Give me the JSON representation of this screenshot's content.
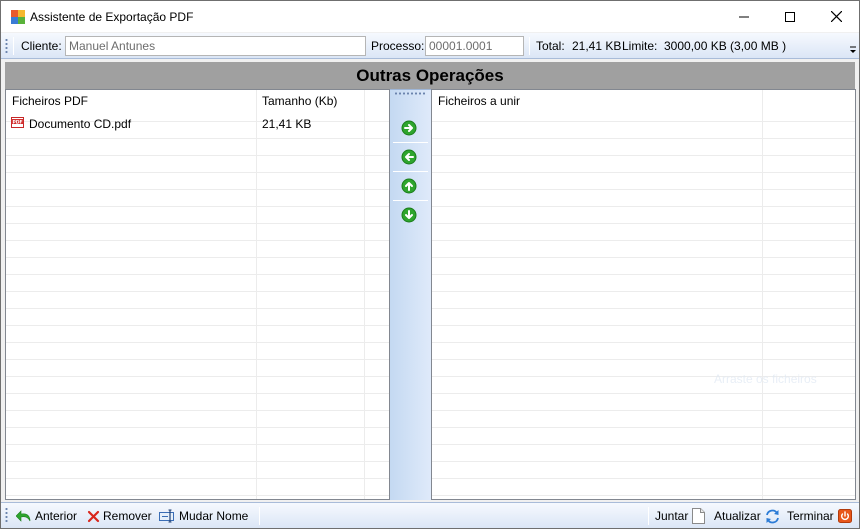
{
  "window": {
    "title": "Assistente de Exportação PDF",
    "controls": [
      "minimize",
      "maximize",
      "close"
    ]
  },
  "toolbar": {
    "client_label": "Cliente:",
    "client_value": "Manuel Antunes",
    "process_label": "Processo:",
    "process_value": "00001.0001",
    "total_label": "Total:",
    "total_value": "21,41 KB",
    "limit_label": "Limite:",
    "limit_value": "3000,00 KB (3,00 MB )"
  },
  "section": {
    "title": "Outras Operações"
  },
  "left_list": {
    "columns": [
      "Ficheiros PDF",
      "Tamanho (Kb)"
    ],
    "rows": [
      {
        "name": "Documento CD.pdf",
        "size": "21,41 KB",
        "icon": "pdf-file-icon"
      }
    ]
  },
  "middle_buttons": [
    {
      "name": "move-right",
      "icon": "arrow-right-icon"
    },
    {
      "name": "move-left",
      "icon": "arrow-left-icon"
    },
    {
      "name": "move-up",
      "icon": "arrow-up-icon"
    },
    {
      "name": "move-down",
      "icon": "arrow-down-icon"
    }
  ],
  "right_list": {
    "columns": [
      "Ficheiros a unir"
    ],
    "rows": []
  },
  "ghost_text": "Arraste os ficheiros",
  "bottom_toolbar": {
    "previous_label": "Anterior",
    "remove_label": "Remover",
    "rename_label": "Mudar Nome",
    "join_label": "Juntar",
    "refresh_label": "Atualizar",
    "finish_label": "Terminar"
  },
  "colors": {
    "header_bg": "#a0a0a0",
    "toolbar_gradient_top": "#f6f9fe",
    "toolbar_gradient_bottom": "#dbe6f6",
    "arrow_green": "#2ea52e",
    "remove_red": "#d9261c",
    "finish_orange": "#e8561a"
  }
}
